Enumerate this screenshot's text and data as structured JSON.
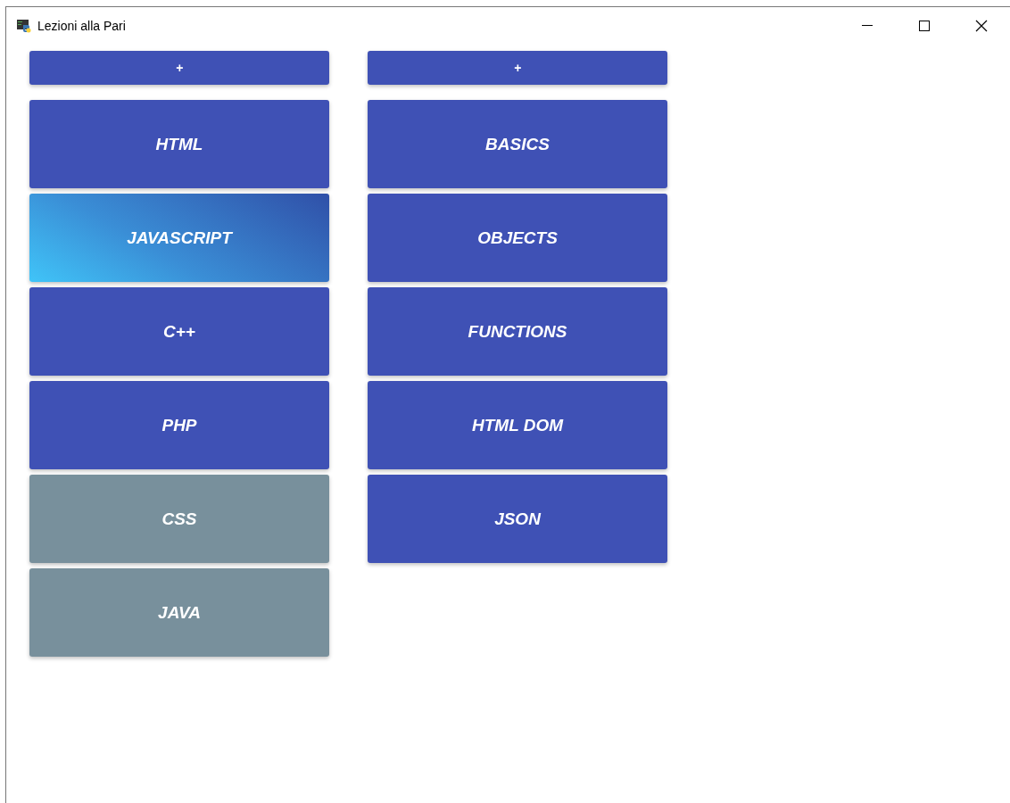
{
  "window": {
    "title": "Lezioni alla Pari"
  },
  "columns": [
    {
      "add_button": "+",
      "items": [
        {
          "label": "HTML",
          "selected": false,
          "disabled": false
        },
        {
          "label": "JAVASCRIPT",
          "selected": true,
          "disabled": false
        },
        {
          "label": "C++",
          "selected": false,
          "disabled": false
        },
        {
          "label": "PHP",
          "selected": false,
          "disabled": false
        },
        {
          "label": "CSS",
          "selected": false,
          "disabled": true
        },
        {
          "label": "JAVA",
          "selected": false,
          "disabled": true
        }
      ]
    },
    {
      "add_button": "+",
      "items": [
        {
          "label": "BASICS",
          "selected": false,
          "disabled": false
        },
        {
          "label": "OBJECTS",
          "selected": false,
          "disabled": false
        },
        {
          "label": "FUNCTIONS",
          "selected": false,
          "disabled": false
        },
        {
          "label": "HTML DOM",
          "selected": false,
          "disabled": false
        },
        {
          "label": "JSON",
          "selected": false,
          "disabled": false
        }
      ]
    }
  ]
}
